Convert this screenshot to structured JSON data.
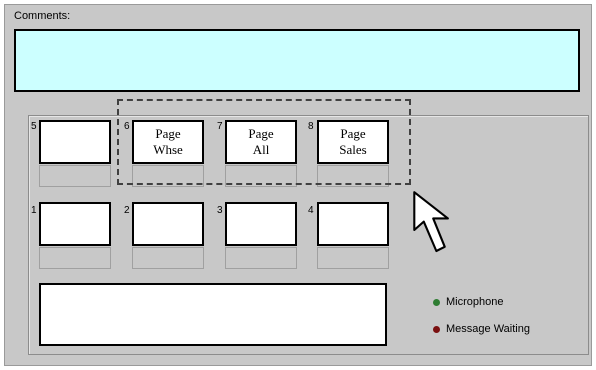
{
  "comments": {
    "label": "Comments:",
    "value": ""
  },
  "keys": {
    "k5": {
      "num": "5",
      "line1": "",
      "line2": ""
    },
    "k6": {
      "num": "6",
      "line1": "Page",
      "line2": "Whse"
    },
    "k7": {
      "num": "7",
      "line1": "Page",
      "line2": "All"
    },
    "k8": {
      "num": "8",
      "line1": "Page",
      "line2": "Sales"
    },
    "k1": {
      "num": "1",
      "line1": "",
      "line2": ""
    },
    "k2": {
      "num": "2",
      "line1": "",
      "line2": ""
    },
    "k3": {
      "num": "3",
      "line1": "",
      "line2": ""
    },
    "k4": {
      "num": "4",
      "line1": "",
      "line2": ""
    }
  },
  "display": {
    "value": ""
  },
  "indicators": {
    "microphone": {
      "label": "Microphone",
      "color": "#2e7d32"
    },
    "message_waiting": {
      "label": "Message Waiting",
      "color": "#7a1010"
    }
  },
  "icons": {
    "pointer": "arrow-cursor-icon"
  }
}
